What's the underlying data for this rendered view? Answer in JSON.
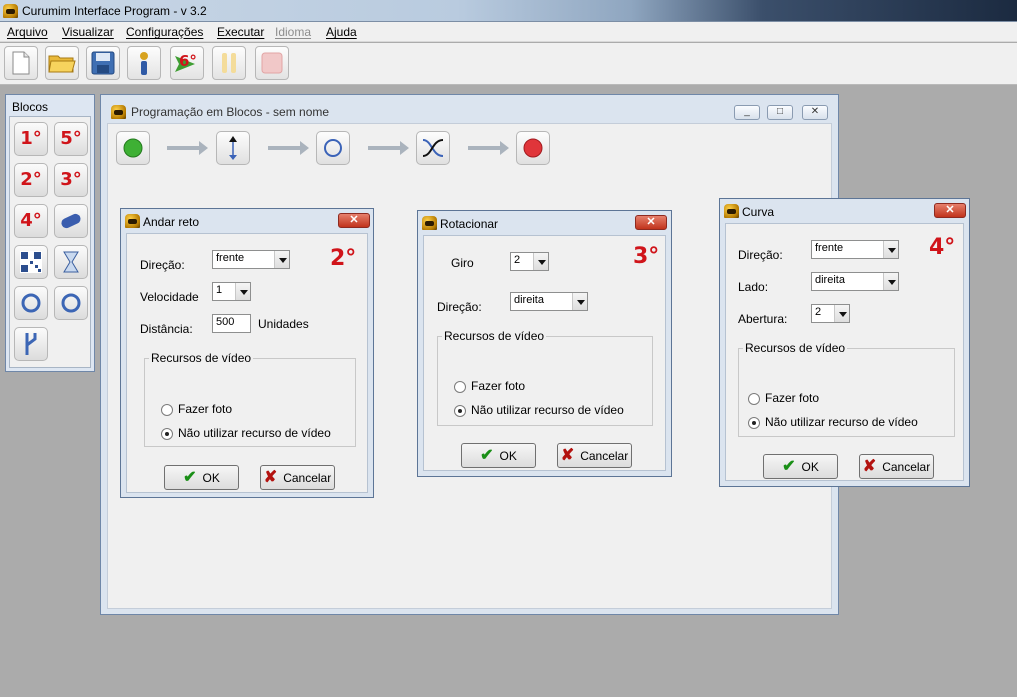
{
  "app": {
    "title": "Curumim Interface Program - v 3.2"
  },
  "menu": [
    {
      "label": "Arquivo",
      "enabled": true
    },
    {
      "label": "Visualizar",
      "enabled": true
    },
    {
      "label": "Configurações",
      "enabled": true
    },
    {
      "label": "Executar",
      "enabled": true
    },
    {
      "label": "Idioma",
      "enabled": false
    },
    {
      "label": "Ajuda",
      "enabled": true
    }
  ],
  "toolbar": {
    "buttons": [
      "new-file-icon",
      "open-folder-icon",
      "save-disk-icon",
      "robot-info-icon",
      "send-6-icon",
      "pause-icon",
      "stop-icon"
    ],
    "send_label": "6°"
  },
  "blocos": {
    "title": "Blocos",
    "ordinals": [
      "1°",
      "5°",
      "2°",
      "3°",
      "4°"
    ]
  },
  "program": {
    "title": "Programação em Blocos - sem nome",
    "window_buttons": [
      "_",
      "□",
      "✕"
    ]
  },
  "dialogs": {
    "andar": {
      "title": "Andar reto",
      "close": "✕",
      "ordinal": "2°",
      "direcao_label": "Direção:",
      "direcao_value": "frente",
      "velocidade_label": "Velocidade",
      "velocidade_value": "1",
      "distancia_label": "Distância:",
      "distancia_value": "500",
      "distancia_unit": "Unidades",
      "video_group": "Recursos de vídeo",
      "opt_foto": "Fazer foto",
      "opt_nao": "Não utilizar recurso de vídeo",
      "ok": "OK",
      "cancel": "Cancelar"
    },
    "rotacionar": {
      "title": "Rotacionar",
      "close": "✕",
      "ordinal": "3°",
      "giro_label": "Giro",
      "giro_value": "2",
      "direcao_label": "Direção:",
      "direcao_value": "direita",
      "video_group": "Recursos de vídeo",
      "opt_foto": "Fazer foto",
      "opt_nao": "Não utilizar recurso de vídeo",
      "ok": "OK",
      "cancel": "Cancelar"
    },
    "curva": {
      "title": "Curva",
      "close": "✕",
      "ordinal": "4°",
      "direcao_label": "Direção:",
      "direcao_value": "frente",
      "lado_label": "Lado:",
      "lado_value": "direita",
      "abertura_label": "Abertura:",
      "abertura_value": "2",
      "video_group": "Recursos de vídeo",
      "opt_foto": "Fazer foto",
      "opt_nao": "Não utilizar recurso de vídeo",
      "ok": "OK",
      "cancel": "Cancelar"
    }
  }
}
